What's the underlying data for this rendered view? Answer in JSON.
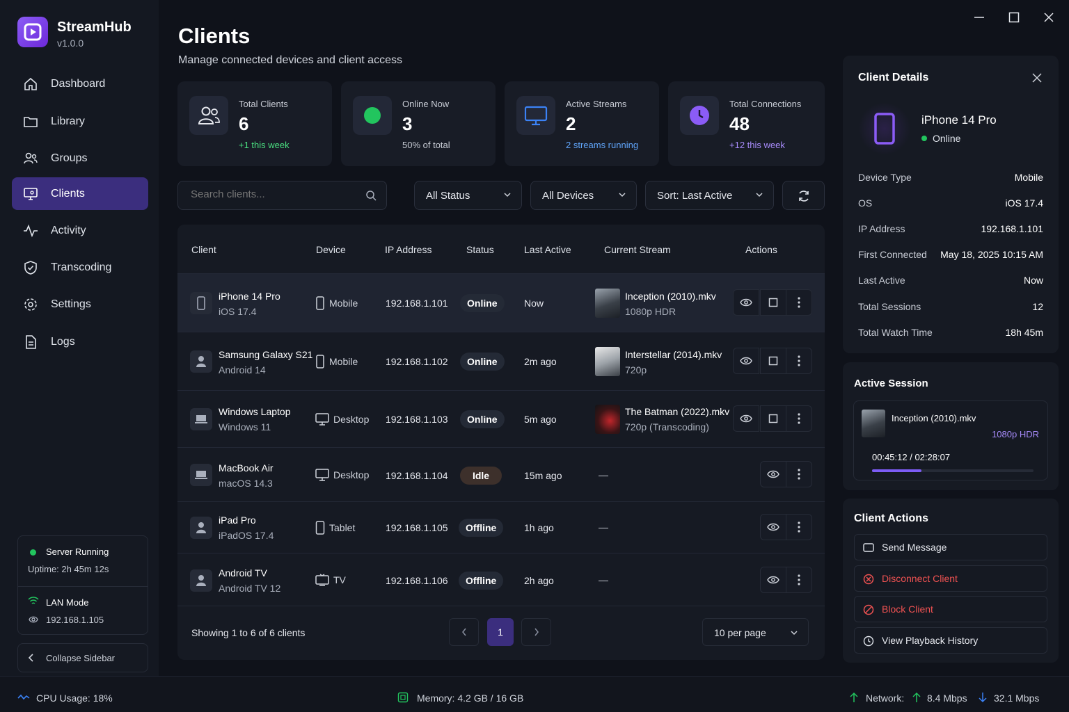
{
  "app": {
    "name": "StreamHub",
    "version": "v1.0.0"
  },
  "nav": [
    {
      "label": "Dashboard",
      "icon": "home-icon"
    },
    {
      "label": "Library",
      "icon": "folder-icon"
    },
    {
      "label": "Groups",
      "icon": "users-icon"
    },
    {
      "label": "Clients",
      "icon": "monitor-user-icon",
      "active": true
    },
    {
      "label": "Activity",
      "icon": "activity-icon"
    },
    {
      "label": "Transcoding",
      "icon": "transcode-icon"
    },
    {
      "label": "Settings",
      "icon": "gear-icon"
    },
    {
      "label": "Logs",
      "icon": "document-icon"
    }
  ],
  "server": {
    "status": "Server Running",
    "uptime": "Uptime: 2h 45m 12s",
    "mode": "LAN Mode",
    "ip": "192.168.1.105"
  },
  "collapse_label": "Collapse Sidebar",
  "page": {
    "title": "Clients",
    "subtitle": "Manage connected devices and client access"
  },
  "stats": [
    {
      "label": "Total Clients",
      "value": "6",
      "sub": "+1 this week",
      "sub_color": "#4ade80"
    },
    {
      "label": "Online Now",
      "value": "3",
      "sub": "50% of total",
      "sub_color": "#c8ccd5"
    },
    {
      "label": "Active Streams",
      "value": "2",
      "sub": "2 streams running",
      "sub_color": "#60a5fa"
    },
    {
      "label": "Total Connections",
      "value": "48",
      "sub": "+12 this week",
      "sub_color": "#a78bfa"
    }
  ],
  "filters": {
    "search_placeholder": "Search clients...",
    "status": "All Status",
    "devices": "All Devices",
    "sort": "Sort: Last Active"
  },
  "table": {
    "headers": [
      "Client",
      "Device",
      "IP Address",
      "Status",
      "Last Active",
      "Current Stream",
      "Actions"
    ],
    "rows": [
      {
        "name": "iPhone 14 Pro",
        "os": "iOS 17.4",
        "device": "Mobile",
        "ip": "192.168.1.101",
        "status": "Online",
        "last": "Now",
        "stream": "Inception (2010).mkv",
        "quality": "1080p HDR"
      },
      {
        "name": "Samsung Galaxy S21",
        "os": "Android 14",
        "device": "Mobile",
        "ip": "192.168.1.102",
        "status": "Online",
        "last": "2m ago",
        "stream": "Interstellar (2014).mkv",
        "quality": "720p"
      },
      {
        "name": "Windows Laptop",
        "os": "Windows 11",
        "device": "Desktop",
        "ip": "192.168.1.103",
        "status": "Online",
        "last": "5m ago",
        "stream": "The Batman (2022).mkv",
        "quality": "720p (Transcoding)"
      },
      {
        "name": "MacBook Air",
        "os": "macOS 14.3",
        "device": "Desktop",
        "ip": "192.168.1.104",
        "status": "Idle",
        "last": "15m ago",
        "stream": "—",
        "quality": ""
      },
      {
        "name": "iPad Pro",
        "os": "iPadOS 17.4",
        "device": "Tablet",
        "ip": "192.168.1.105",
        "status": "Offline",
        "last": "1h ago",
        "stream": "—",
        "quality": ""
      },
      {
        "name": "Android TV",
        "os": "Android TV 12",
        "device": "TV",
        "ip": "192.168.1.106",
        "status": "Offline",
        "last": "2h ago",
        "stream": "—",
        "quality": ""
      }
    ],
    "showing": "Showing 1 to 6 of 6 clients",
    "page": "1",
    "per_page": "10 per page"
  },
  "details": {
    "title": "Client Details",
    "name": "iPhone 14 Pro",
    "status": "Online",
    "fields": [
      {
        "k": "Device Type",
        "v": "Mobile"
      },
      {
        "k": "OS",
        "v": "iOS 17.4"
      },
      {
        "k": "IP Address",
        "v": "192.168.1.101"
      },
      {
        "k": "First Connected",
        "v": "May 18, 2025 10:15 AM"
      },
      {
        "k": "Last Active",
        "v": "Now"
      },
      {
        "k": "Total Sessions",
        "v": "12"
      },
      {
        "k": "Total Watch Time",
        "v": "18h 45m"
      }
    ]
  },
  "session": {
    "title": "Active Session",
    "file": "Inception (2010).mkv",
    "quality": "1080p HDR",
    "time": "00:45:12 / 02:28:07",
    "progress": 0.305
  },
  "client_actions": {
    "title": "Client Actions",
    "items": [
      {
        "label": "Send Message",
        "color": "#e6e8ee"
      },
      {
        "label": "Disconnect Client",
        "color": "#f05252"
      },
      {
        "label": "Block Client",
        "color": "#f05252"
      },
      {
        "label": "View Playback History",
        "color": "#e6e8ee"
      }
    ]
  },
  "footer": {
    "cpu": "CPU Usage: 18%",
    "memory": "Memory: 4.2 GB / 16 GB",
    "network_label": "Network:",
    "up": "8.4 Mbps",
    "down": "32.1 Mbps"
  },
  "colors": {
    "accent": "#7c5cf5",
    "online": "#22c55e"
  }
}
